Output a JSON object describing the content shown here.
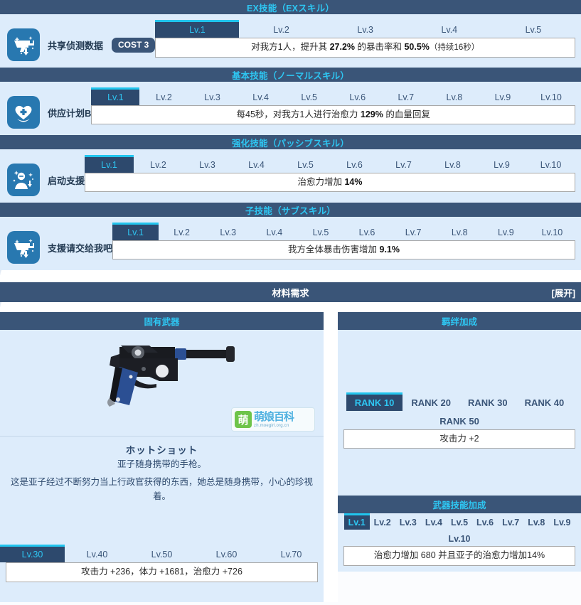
{
  "skills": [
    {
      "section_title": "EX技能（EXスキル）",
      "icon": "pistol-up-icon",
      "name": "共享侦测数据",
      "cost": "COST 3",
      "levels": [
        "Lv.1",
        "Lv.2",
        "Lv.3",
        "Lv.4",
        "Lv.5"
      ],
      "active_level": 0,
      "desc_parts": [
        {
          "t": "对我方1人，提升其 ",
          "b": false
        },
        {
          "t": "27.2%",
          "b": true
        },
        {
          "t": " 的暴击率和 ",
          "b": false
        },
        {
          "t": "50.5%",
          "b": true
        },
        {
          "t": "（持续16秒）",
          "b": false,
          "small": true
        }
      ],
      "desc_plain": "对我方1人，提升其 27.2% 的暴击率和 50.5%（持续16秒）"
    },
    {
      "section_title": "基本技能（ノーマルスキル）",
      "icon": "heart-plus-icon",
      "name": "供应计划B",
      "cost": "",
      "levels": [
        "Lv.1",
        "Lv.2",
        "Lv.3",
        "Lv.4",
        "Lv.5",
        "Lv.6",
        "Lv.7",
        "Lv.8",
        "Lv.9",
        "Lv.10"
      ],
      "active_level": 0,
      "desc_parts": [
        {
          "t": "每45秒，对我方1人进行治愈力 ",
          "b": false
        },
        {
          "t": "129%",
          "b": true
        },
        {
          "t": " 的血量回复",
          "b": false
        }
      ],
      "desc_plain": "每45秒，对我方1人进行治愈力 129% 的血量回复"
    },
    {
      "section_title": "强化技能（パッシブスキル）",
      "icon": "person-sparkle-icon",
      "name": "启动支援",
      "cost": "",
      "levels": [
        "Lv.1",
        "Lv.2",
        "Lv.3",
        "Lv.4",
        "Lv.5",
        "Lv.6",
        "Lv.7",
        "Lv.8",
        "Lv.9",
        "Lv.10"
      ],
      "active_level": 0,
      "desc_parts": [
        {
          "t": "治愈力增加 ",
          "b": false
        },
        {
          "t": "14%",
          "b": true
        }
      ],
      "desc_plain": "治愈力增加 14%"
    },
    {
      "section_title": "子技能（サブスキル）",
      "icon": "pistol-up-icon",
      "name": "支援请交给我吧",
      "cost": "",
      "levels": [
        "Lv.1",
        "Lv.2",
        "Lv.3",
        "Lv.4",
        "Lv.5",
        "Lv.6",
        "Lv.7",
        "Lv.8",
        "Lv.9",
        "Lv.10"
      ],
      "active_level": 0,
      "desc_parts": [
        {
          "t": "我方全体暴击伤害增加 ",
          "b": false
        },
        {
          "t": "9.1%",
          "b": true
        }
      ],
      "desc_plain": "我方全体暴击伤害增加 9.1%"
    }
  ],
  "material": {
    "title": "材料需求",
    "expand": "[展开]"
  },
  "weapon": {
    "header": "固有武器",
    "image_name": "luger-pistol-image",
    "watermark": {
      "badge": "萌",
      "main": "萌娘百科",
      "sub": "zh.moegirl.org.cn"
    },
    "name": "ホットショット",
    "desc_line1": "亚子随身携带的手枪。",
    "desc_line2": "这是亚子经过不断努力当上行政官获得的东西，她总是随身携带，小心的珍视着。",
    "levels": [
      "Lv.30",
      "Lv.40",
      "Lv.50",
      "Lv.60",
      "Lv.70"
    ],
    "active_level": 0,
    "stats": "攻击力 +236，体力 +1681，治愈力 +726"
  },
  "bond": {
    "header": "羁绊加成",
    "ranks": [
      "RANK 10",
      "RANK 20",
      "RANK 30",
      "RANK 40",
      "RANK 50"
    ],
    "active_rank": 0,
    "effect": "攻击力 +2"
  },
  "weapon_skill": {
    "header": "武器技能加成",
    "levels": [
      "Lv.1",
      "Lv.2",
      "Lv.3",
      "Lv.4",
      "Lv.5",
      "Lv.6",
      "Lv.7",
      "Lv.8",
      "Lv.9",
      "Lv.10"
    ],
    "active_level": 0,
    "effect": "治愈力增加 680 并且亚子的治愈力增加14%"
  },
  "colors": {
    "band": "#3a5578",
    "band_text": "#2ec6f2",
    "panel_bg": "#ddecfb",
    "tab_active_bg": "#2d496d",
    "tab_active_top": "#21c5ee",
    "tab_active_text": "#2ec6f2",
    "tab_text": "#3a5578",
    "desc_bg": "#ffffff"
  }
}
